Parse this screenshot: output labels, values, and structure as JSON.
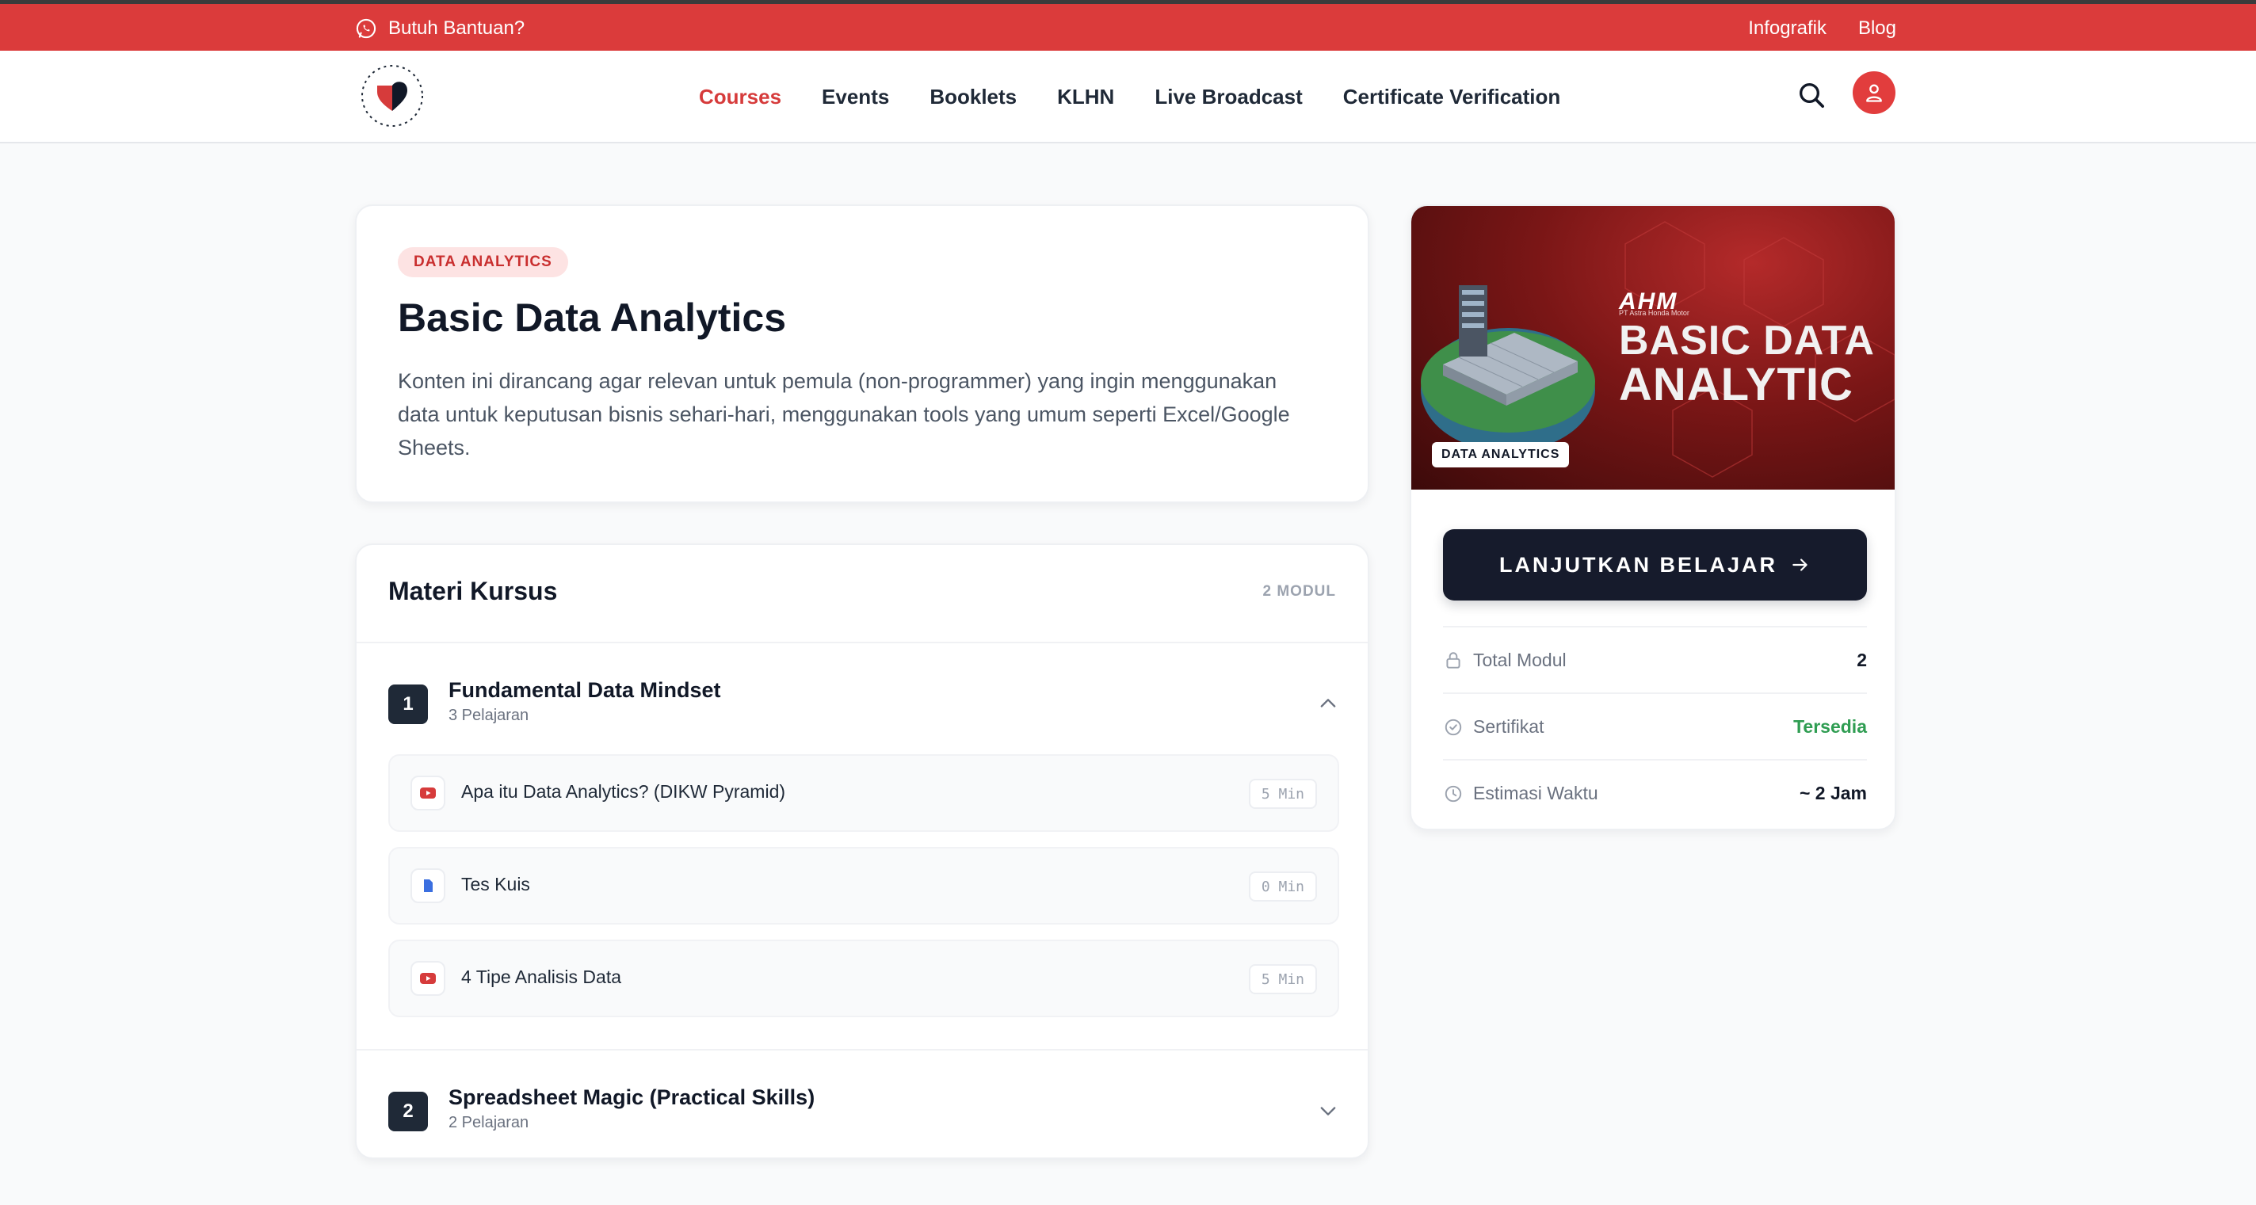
{
  "topbar": {
    "help_label": "Butuh Bantuan?",
    "links": [
      "Infografik",
      "Blog"
    ]
  },
  "nav": {
    "items": [
      "Courses",
      "Events",
      "Booklets",
      "KLHN",
      "Live Broadcast",
      "Certificate Verification"
    ],
    "active": "Courses"
  },
  "course": {
    "category": "DATA ANALYTICS",
    "title": "Basic Data Analytics",
    "description": "Konten ini dirancang agar relevan untuk pemula (non-programmer) yang ingin menggunakan data untuk keputusan bisnis sehari-hari, menggunakan tools yang umum seperti Excel/Google Sheets."
  },
  "materi": {
    "title": "Materi Kursus",
    "count": "2 MODUL",
    "modules": [
      {
        "number": "1",
        "title": "Fundamental Data Mindset",
        "subtitle": "3 Pelajaran",
        "expanded": true,
        "lessons": [
          {
            "icon": "youtube-icon",
            "title": "Apa itu Data Analytics? (DIKW Pyramid)",
            "duration": "5 Min"
          },
          {
            "icon": "document-icon",
            "title": "Tes Kuis",
            "duration": "0 Min"
          },
          {
            "icon": "youtube-icon",
            "title": "4 Tipe Analisis Data",
            "duration": "5 Min"
          }
        ]
      },
      {
        "number": "2",
        "title": "Spreadsheet Magic (Practical Skills)",
        "subtitle": "2 Pelajaran",
        "expanded": false
      }
    ]
  },
  "sidebar": {
    "banner": {
      "brand": "AHM",
      "brand_sub": "PT Astra Honda Motor",
      "line1": "BASIC DATA",
      "line2": "ANALYTIC",
      "tag": "DATA ANALYTICS"
    },
    "cta_label": "LANJUTKAN BELAJAR",
    "info": [
      {
        "icon": "lock-icon",
        "label": "Total Modul",
        "value": "2"
      },
      {
        "icon": "certificate-check-icon",
        "label": "Sertifikat",
        "value": "Tersedia"
      },
      {
        "icon": "clock-icon",
        "label": "Estimasi Waktu",
        "value": "~ 2 Jam"
      }
    ]
  },
  "colors": {
    "brand_red": "#db3b3b",
    "dark": "#161b2c",
    "green": "#2f9d52"
  }
}
